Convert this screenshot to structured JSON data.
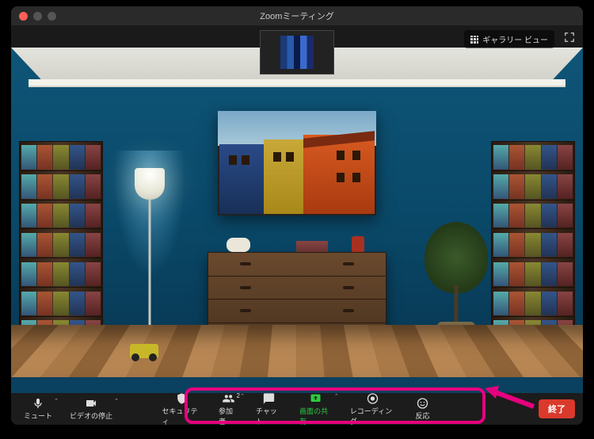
{
  "window": {
    "title": "Zoomミーティング"
  },
  "top": {
    "gallery_label": "ギャラリー ビュー"
  },
  "toolbar": {
    "mute": "ミュート",
    "video": "ビデオの停止",
    "security": "セキュリティ",
    "participants": "参加者",
    "participants_count": "2",
    "chat": "チャット",
    "share": "画面の共有",
    "record": "レコーディング",
    "reactions": "反応",
    "end": "終了"
  }
}
